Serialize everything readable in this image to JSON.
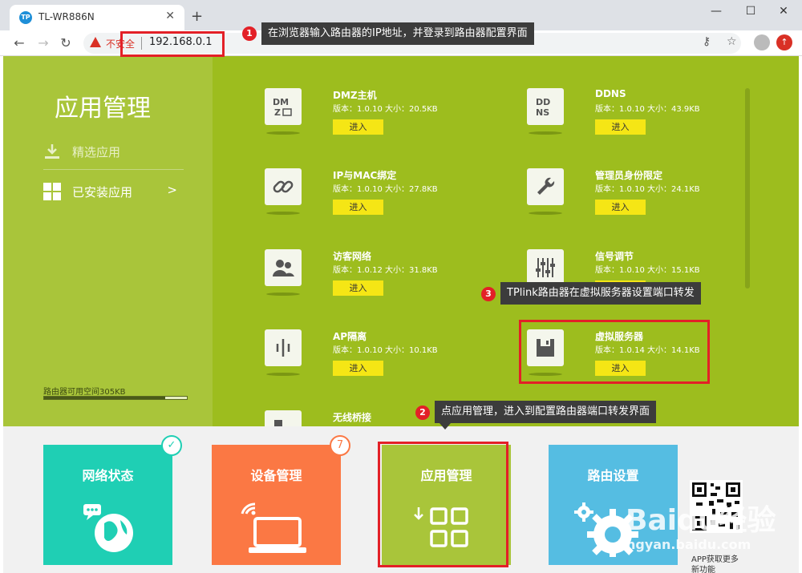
{
  "browser": {
    "tab_title": "TL-WR886N",
    "tab_favicon": "TP",
    "new_tab": "+",
    "close": "✕",
    "win_min": "—",
    "win_max": "☐",
    "win_close": "✕",
    "not_secure": "不安全",
    "url": "192.168.0.1"
  },
  "sidebar": {
    "title": "应用管理",
    "items": [
      {
        "label": "精选应用"
      },
      {
        "label": "已安装应用",
        "arrow": ">"
      }
    ],
    "storage_label": "路由器可用空间305KB",
    "storage_fraction": 0.85
  },
  "apps": [
    {
      "name": "DMZ主机",
      "meta": "版本：1.0.10 大小：20.5KB",
      "button": "进入",
      "icon": "dmz-icon"
    },
    {
      "name": "DDNS",
      "meta": "版本：1.0.10 大小：43.9KB",
      "button": "进入",
      "icon": "ddns-icon"
    },
    {
      "name": "IP与MAC绑定",
      "meta": "版本：1.0.10 大小：27.8KB",
      "button": "进入",
      "icon": "link-icon"
    },
    {
      "name": "管理员身份限定",
      "meta": "版本：1.0.10 大小：24.1KB",
      "button": "进入",
      "icon": "wrench-icon"
    },
    {
      "name": "访客网络",
      "meta": "版本：1.0.12 大小：31.8KB",
      "button": "进入",
      "icon": "guest-icon"
    },
    {
      "name": "信号调节",
      "meta": "版本：1.0.10 大小：15.1KB",
      "button": "进入",
      "icon": "equalizer-icon"
    },
    {
      "name": "AP隔离",
      "meta": "版本：1.0.10 大小：10.1KB",
      "button": "进入",
      "icon": "ap-isolation-icon"
    },
    {
      "name": "虚拟服务器",
      "meta": "版本：1.0.14 大小：14.1KB",
      "button": "进入",
      "icon": "floppy-icon"
    },
    {
      "name": "无线桥接",
      "meta": "",
      "button": "",
      "icon": "bridge-icon"
    }
  ],
  "tiles": [
    {
      "title": "网络状态",
      "color": "#1fcfb4",
      "badge": "✓"
    },
    {
      "title": "设备管理",
      "color": "#fb7844",
      "badge": "7"
    },
    {
      "title": "应用管理",
      "color": "#a9c53a",
      "badge": ""
    },
    {
      "title": "路由设置",
      "color": "#55bde2",
      "badge": ""
    }
  ],
  "annotations": [
    {
      "num": "1",
      "text": "在浏览器输入路由器的IP地址，并登录到路由器配置界面"
    },
    {
      "num": "2",
      "text": "点应用管理，进入到配置路由器端口转发界面"
    },
    {
      "num": "3",
      "text": "TPlink路由器在虚拟服务器设置端口转发"
    }
  ],
  "watermark": {
    "brand": "Baidu经验",
    "site": "jingyan.baidu.com",
    "qr_caption_1": "APP获取更多",
    "qr_caption_2": "新功能"
  },
  "colors": {
    "sidebar": "#a9c53a",
    "main": "#9dbd1e",
    "button": "#f5e615",
    "annotation_red": "#e32027"
  }
}
